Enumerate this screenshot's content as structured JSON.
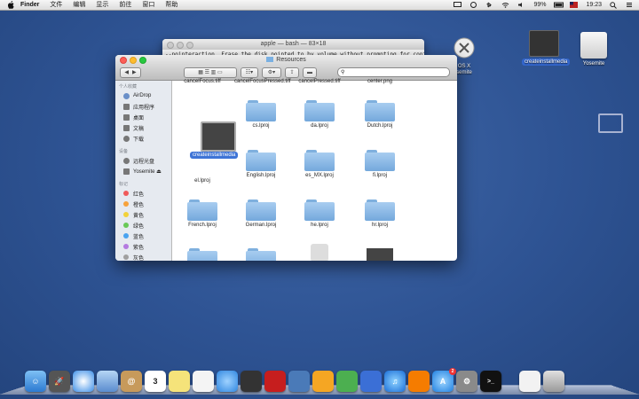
{
  "menubar": {
    "app": "Finder",
    "items": [
      "文件",
      "编辑",
      "显示",
      "前往",
      "窗口",
      "帮助"
    ],
    "battery": "99%",
    "time": "19:23"
  },
  "desktop": {
    "icons": [
      {
        "label": "OS X\nsemite"
      },
      {
        "label": "createinstallmedia"
      },
      {
        "label": "Yosemite"
      }
    ]
  },
  "terminal": {
    "title": "apple — bash — 83×18",
    "line": "--nointeraction, Erase the disk pointed to by volume without prompting for confirma"
  },
  "finder": {
    "title": "Resources",
    "search_placeholder": "",
    "sidebar": {
      "sections": [
        {
          "head": "个人收藏",
          "items": [
            "AirDrop",
            "应用程序",
            "桌面",
            "文稿",
            "下载"
          ]
        },
        {
          "head": "设备",
          "items": [
            "远程光盘",
            "Yosemite ⏏"
          ]
        },
        {
          "head": "标记",
          "items": [
            "红色",
            "橙色",
            "黄色",
            "绿色",
            "蓝色",
            "紫色",
            "灰色"
          ]
        }
      ]
    },
    "top_row": [
      "cancelFocus.tiff",
      "cancelFocusPressed.tiff",
      "cancelPressed.tiff",
      "center.png"
    ],
    "dragging_label": "createinstallmedia",
    "items": [
      "cs.lproj",
      "da.lproj",
      "Dutch.lproj",
      "el.lproj",
      "English.lproj",
      "es_MX.lproj",
      "fi.lproj",
      "French.lproj",
      "German.lproj",
      "he.lproj",
      "hr.lproj"
    ]
  },
  "colors": {
    "tag_red": "#f05a5a",
    "tag_orange": "#f7a23b",
    "tag_yellow": "#f2d23a",
    "tag_green": "#69c957",
    "tag_blue": "#4aa3f0",
    "tag_purple": "#b47ae0",
    "tag_gray": "#a0a0a0"
  },
  "dock": {
    "apps": [
      "finder",
      "launchpad",
      "safari",
      "mail",
      "contacts",
      "calendar",
      "notes",
      "reminders",
      "messages",
      "facetime",
      "photo-booth",
      "iphoto",
      "pages",
      "numbers",
      "keynote",
      "itunes",
      "ibooks",
      "app-store",
      "system-preferences",
      "terminal",
      "document",
      "trash"
    ],
    "calendar_day": "3",
    "appstore_badge": "2"
  }
}
